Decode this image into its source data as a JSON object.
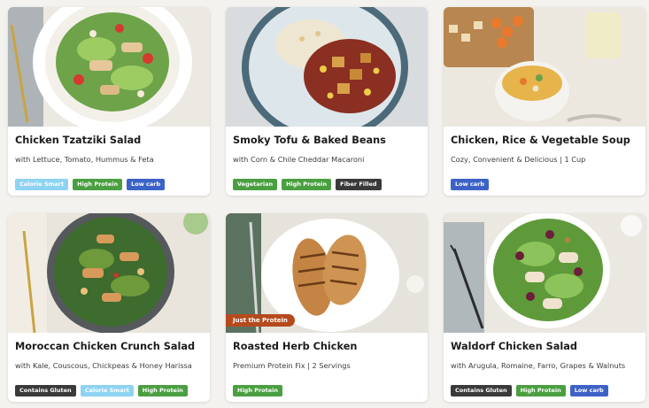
{
  "colors": {
    "page_background": "#f4f2ee",
    "calorie_smart": "#8fd3f2",
    "high_protein": "#4a9f40",
    "low_carb": "#3d62c7",
    "dark_tag": "#3a3a3a",
    "just_the_protein": "#b64a1c"
  },
  "cards": [
    {
      "title": "Chicken Tzatziki Salad",
      "subtitle": "with Lettuce, Tomato, Hummus & Feta",
      "image": "chicken-tzatziki-salad-photo",
      "badges": [
        "Calorie Smart",
        "High Protein",
        "Low carb"
      ]
    },
    {
      "title": "Smoky Tofu & Baked Beans",
      "subtitle": "with Corn & Chile Cheddar Macaroni",
      "image": "smoky-tofu-baked-beans-photo",
      "badges": [
        "Vegetarian",
        "High Protein",
        "Fiber Filled"
      ]
    },
    {
      "title": "Chicken, Rice & Vegetable Soup",
      "subtitle": "Cozy, Convenient & Delicious | 1 Cup",
      "image": "chicken-rice-vegetable-soup-photo",
      "badges": [
        "Low carb"
      ]
    },
    {
      "title": "Moroccan Chicken Crunch Salad",
      "subtitle": "with Kale, Couscous, Chickpeas & Honey Harissa",
      "image": "moroccan-chicken-crunch-salad-photo",
      "badges": [
        "Contains Gluten",
        "Calorie Smart",
        "High Protein"
      ]
    },
    {
      "title": "Roasted Herb Chicken",
      "subtitle": "Premium Protein Fix | 2 Servings",
      "image": "roasted-herb-chicken-photo",
      "overlay_tag": "Just the Protein",
      "badges": [
        "High Protein"
      ]
    },
    {
      "title": "Waldorf Chicken Salad",
      "subtitle": "with Arugula, Romaine, Farro, Grapes & Walnuts",
      "image": "waldorf-chicken-salad-photo",
      "badges": [
        "Contains Gluten",
        "High Protein",
        "Low carb"
      ]
    }
  ]
}
